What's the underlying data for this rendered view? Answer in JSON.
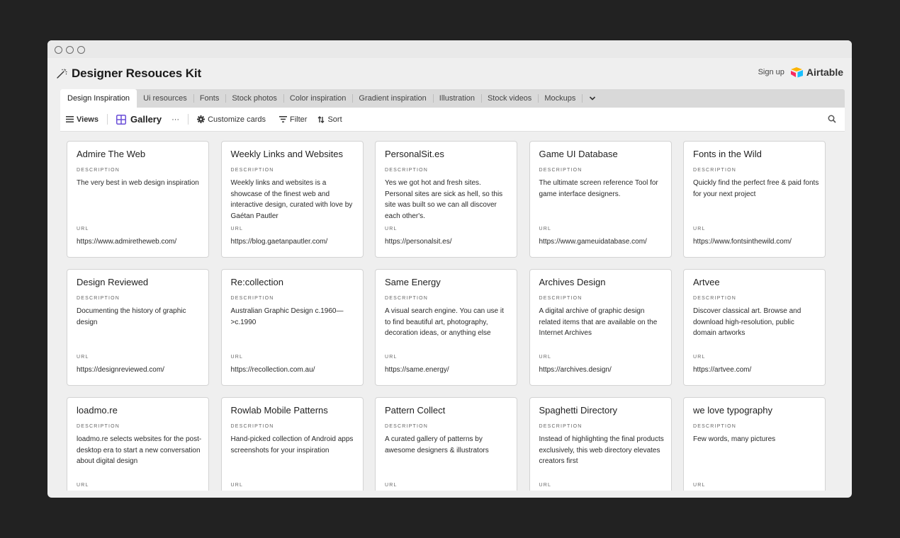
{
  "base": {
    "title": "Designer Resouces Kit",
    "icon": "magic-wand-icon"
  },
  "header": {
    "signup": "Sign up",
    "brand": "Airtable"
  },
  "tabs": [
    {
      "label": "Design Inspiration",
      "active": true
    },
    {
      "label": "Ui resources"
    },
    {
      "label": "Fonts"
    },
    {
      "label": "Stock photos"
    },
    {
      "label": "Color inspiration"
    },
    {
      "label": "Gradient inspiration"
    },
    {
      "label": "Illustration"
    },
    {
      "label": "Stock videos"
    },
    {
      "label": "Mockups"
    }
  ],
  "toolbar": {
    "views": "Views",
    "view_name": "Gallery",
    "more": "···",
    "customize": "Customize cards",
    "filter": "Filter",
    "sort": "Sort"
  },
  "field_labels": {
    "description": "DESCRIPTION",
    "url": "URL"
  },
  "cards": [
    {
      "title": "Admire The Web",
      "description": "The very best in web design inspiration",
      "url": "https://www.admiretheweb.com/"
    },
    {
      "title": "Weekly Links and Websites",
      "description": "Weekly links and websites is a showcase of the finest web and interactive design, curated with love by Gaétan Pautler",
      "url": "https://blog.gaetanpautler.com/"
    },
    {
      "title": "PersonalSit.es",
      "description": "Yes we got hot and fresh sites. Personal sites are sick as hell, so this site was built so we can all discover each other's.",
      "url": "https://personalsit.es/"
    },
    {
      "title": "Game UI Database",
      "description": "The ultimate screen reference Tool for game interface designers.",
      "url": "https://www.gameuidatabase.com/"
    },
    {
      "title": "Fonts in the Wild",
      "description": "Quickly find the perfect free & paid fonts for your next project",
      "url": "https://www.fontsinthewild.com/"
    },
    {
      "title": "Design Reviewed",
      "description": "Documenting the history of graphic design",
      "url": "https://designreviewed.com/"
    },
    {
      "title": "Re:collection",
      "description": "Australian Graphic Design c.1960—>c.1990",
      "url": "https://recollection.com.au/"
    },
    {
      "title": "Same Energy",
      "description": "A visual search engine. You can use it to find beautiful art, photography, decoration ideas, or anything else",
      "url": "https://same.energy/"
    },
    {
      "title": "Archives Design",
      "description": "A digital archive of graphic design related items that are available on the Internet Archives",
      "url": "https://archives.design/"
    },
    {
      "title": "Artvee",
      "description": "Discover classical art. Browse and download high-resolution, public domain artworks",
      "url": "https://artvee.com/"
    },
    {
      "title": "loadmo.re",
      "description": "loadmo.re selects websites for the post-desktop era to start a new conversation about digital design",
      "url": ""
    },
    {
      "title": "Rowlab Mobile Patterns",
      "description": "Hand-picked collection of Android apps screenshots for your inspiration",
      "url": ""
    },
    {
      "title": "Pattern Collect",
      "description": "A curated gallery of patterns by awesome designers & illustrators",
      "url": ""
    },
    {
      "title": "Spaghetti Directory",
      "description": "Instead of highlighting the final products exclusively, this web directory elevates creators first",
      "url": ""
    },
    {
      "title": "we love typography",
      "description": "Few words, many pictures",
      "url": ""
    }
  ],
  "colors": {
    "gallery_icon": "#6b4fd8",
    "airtable_yellow": "#fcb400",
    "airtable_blue": "#18bfff",
    "airtable_red": "#f82b60"
  }
}
